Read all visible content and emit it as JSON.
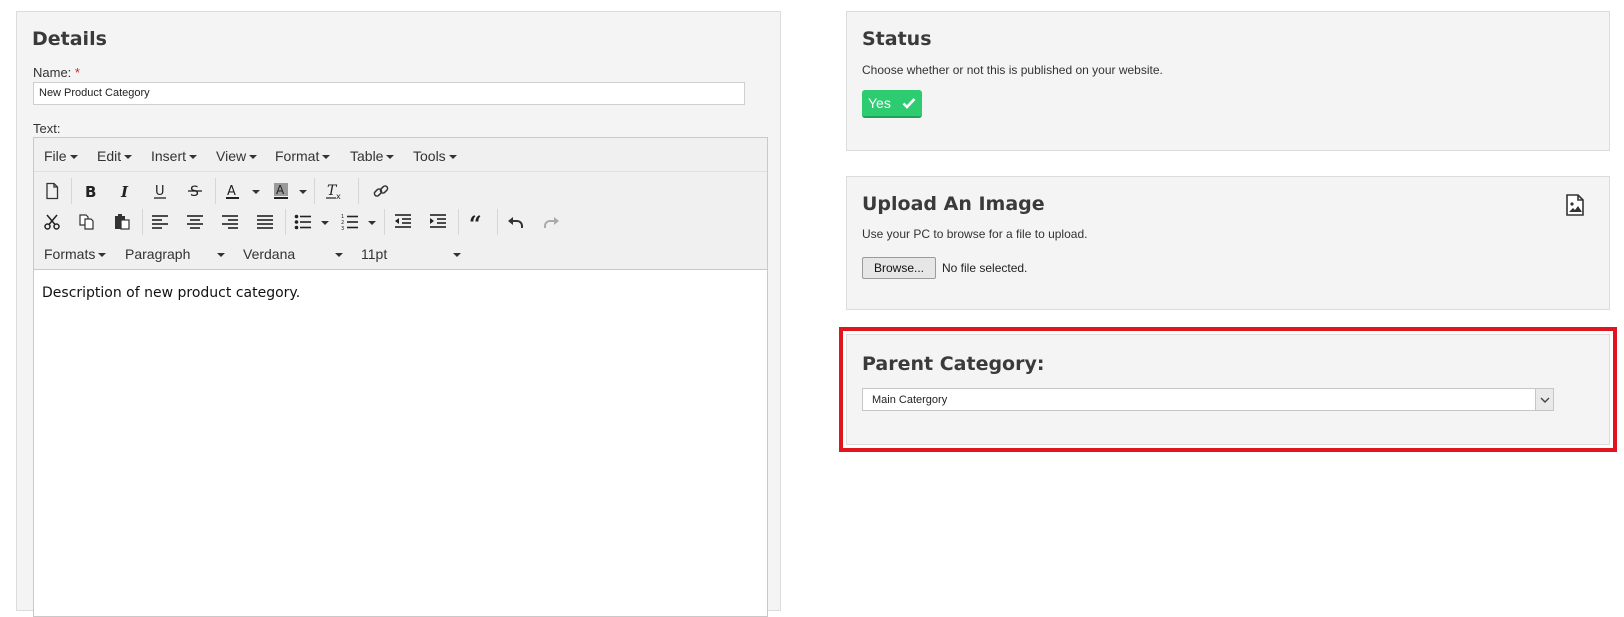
{
  "details": {
    "title": "Details",
    "name_label": "Name:",
    "required_mark": "*",
    "name_value": "New Product Category",
    "text_label": "Text:"
  },
  "editor": {
    "menus": [
      "File",
      "Edit",
      "Insert",
      "View",
      "Format",
      "Table",
      "Tools"
    ],
    "formats_label": "Formats",
    "block_format": "Paragraph",
    "font_family": "Verdana",
    "font_size": "11pt",
    "content": "Description of new product category."
  },
  "status": {
    "title": "Status",
    "description": "Choose whether or not this is published on your website.",
    "toggle_label": "Yes",
    "toggle_color": "#2ecc71"
  },
  "upload": {
    "title": "Upload An Image",
    "description": "Use your PC to browse for a file to upload.",
    "browse_label": "Browse...",
    "no_file_text": "No file selected."
  },
  "parent_category": {
    "title": "Parent Category:",
    "selected": "Main Catergory"
  },
  "highlight_color": "#e0161f"
}
